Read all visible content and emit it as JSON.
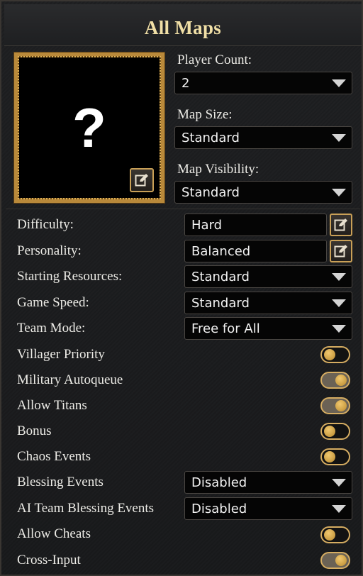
{
  "header": {
    "title": "All Maps"
  },
  "preview": {
    "placeholder": "?"
  },
  "player_count": {
    "label": "Player Count:",
    "value": "2"
  },
  "map_size": {
    "label": "Map Size:",
    "value": "Standard"
  },
  "map_visibility": {
    "label": "Map Visibility:",
    "value": "Standard"
  },
  "settings": {
    "difficulty": {
      "label": "Difficulty:",
      "value": "Hard"
    },
    "personality": {
      "label": "Personality:",
      "value": "Balanced"
    },
    "starting_resources": {
      "label": "Starting Resources:",
      "value": "Standard"
    },
    "game_speed": {
      "label": "Game Speed:",
      "value": "Standard"
    },
    "team_mode": {
      "label": "Team Mode:",
      "value": "Free for All"
    },
    "villager_priority": {
      "label": "Villager Priority",
      "state": "off"
    },
    "military_autoqueue": {
      "label": "Military Autoqueue",
      "state": "on"
    },
    "allow_titans": {
      "label": "Allow Titans",
      "state": "on"
    },
    "bonus": {
      "label": "Bonus",
      "state": "off"
    },
    "chaos_events": {
      "label": "Chaos Events",
      "state": "off"
    },
    "blessing_events": {
      "label": "Blessing Events",
      "value": "Disabled"
    },
    "ai_team_blessing_events": {
      "label": "AI Team Blessing Events",
      "value": "Disabled"
    },
    "allow_cheats": {
      "label": "Allow Cheats",
      "state": "off"
    },
    "cross_input": {
      "label": "Cross-Input",
      "state": "on"
    }
  },
  "icons": {
    "edit": "edit-pencil-icon",
    "dropdown": "chevron-down-icon"
  },
  "colors": {
    "accent_gold": "#d6ad62",
    "title": "#f0dfa6",
    "field_bg": "#050505"
  }
}
